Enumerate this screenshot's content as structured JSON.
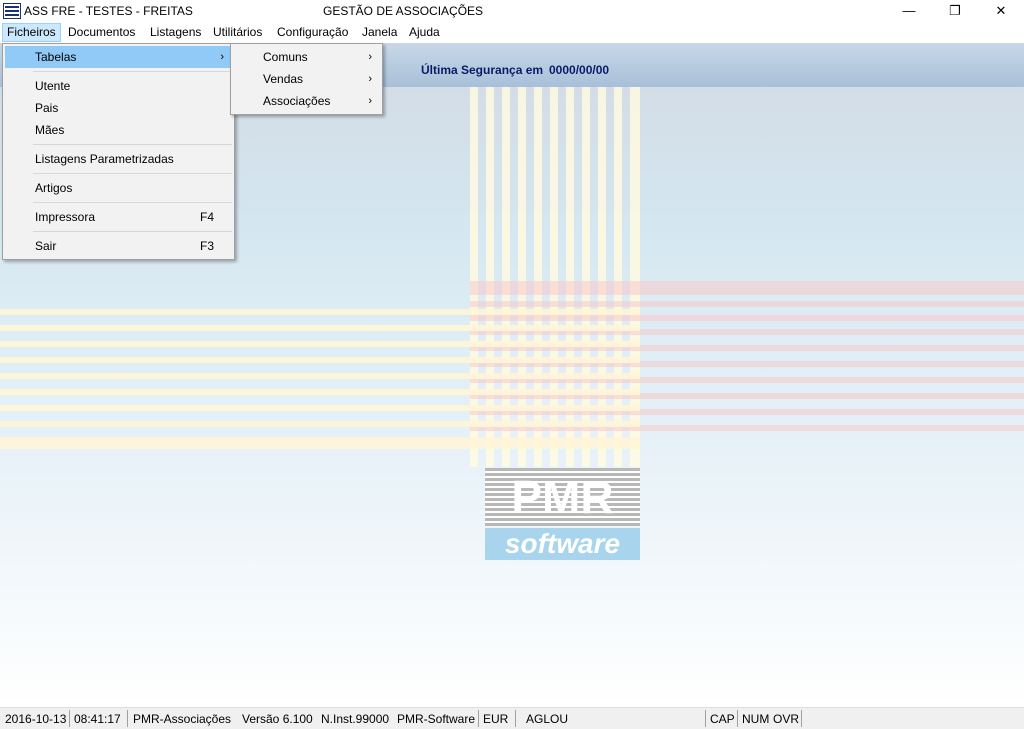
{
  "window": {
    "app_title": "ASS FRE - TESTES - FREITAS",
    "center_title": "GESTÃO DE ASSOCIAÇÕES",
    "minimize_glyph": "—",
    "restore_glyph": "❐",
    "close_glyph": "✕"
  },
  "menubar": {
    "items": [
      "Ficheiros",
      "Documentos",
      "Listagens",
      "Utilitários",
      "Configuração",
      "Janela",
      "Ajuda"
    ]
  },
  "ficheiros_menu": {
    "tabelas": "Tabelas",
    "utente": "Utente",
    "pais": "Pais",
    "maes": "Mães",
    "listagens_parametrizadas": "Listagens Parametrizadas",
    "artigos": "Artigos",
    "impressora": "Impressora",
    "impressora_shortcut": "F4",
    "sair": "Sair",
    "sair_shortcut": "F3",
    "arrow": "›"
  },
  "tabelas_submenu": {
    "comuns": "Comuns",
    "vendas": "Vendas",
    "associacoes": "Associações"
  },
  "info": {
    "security_label": "Última Segurança em",
    "security_value": "0000/00/00"
  },
  "logo": {
    "brand": "PMR",
    "tagline": "software"
  },
  "statusbar": {
    "date": "2016-10-13",
    "time": "08:41:17",
    "app": "PMR-Associações",
    "version": "Versão  6.100",
    "install": "N.Inst.99000",
    "company": "PMR-Software",
    "currency": "EUR",
    "user": "AGLOU",
    "cap": "CAP",
    "num": "NUM",
    "ovr": "OVR"
  },
  "colors": {
    "menu_highlight": "#91c9f7",
    "info_text": "#0a1a6a",
    "logo_blue": "#a8d4ee"
  }
}
